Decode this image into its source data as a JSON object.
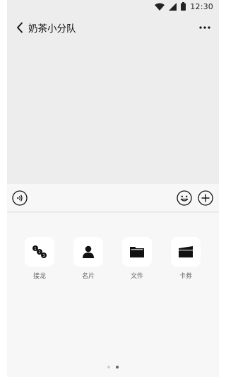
{
  "status_bar": {
    "time": "12:30"
  },
  "header": {
    "title": "奶茶小分队"
  },
  "input_bar": {
    "value": "",
    "placeholder": ""
  },
  "tools": [
    {
      "label": "接龙",
      "icon": "relay-icon"
    },
    {
      "label": "名片",
      "icon": "contact-card-icon"
    },
    {
      "label": "文件",
      "icon": "folder-icon"
    },
    {
      "label": "卡券",
      "icon": "coupon-icon"
    }
  ],
  "pager": {
    "current_page": 2,
    "total_pages": 2
  },
  "colors": {
    "background": "#ededed",
    "panel": "#f7f7f7",
    "icon": "#111111"
  }
}
